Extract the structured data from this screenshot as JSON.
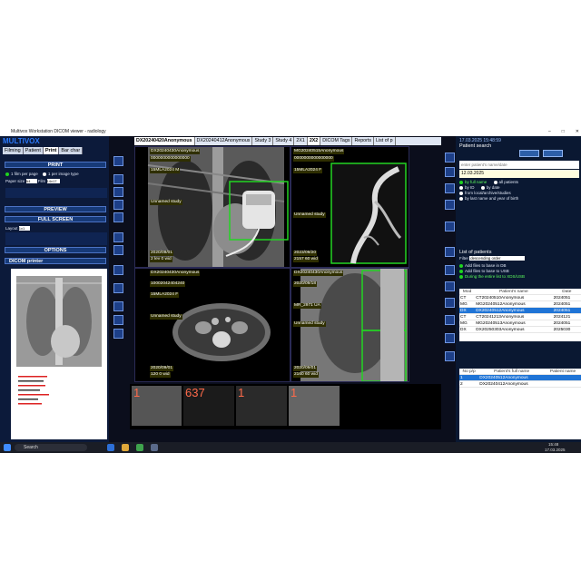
{
  "window": {
    "title": "Multivox Workstation DICOM viewer - radiology"
  },
  "left": {
    "brand": "MULTIVOX",
    "tabs": [
      "Filming",
      "Patient",
      "Print",
      "Bar char"
    ],
    "print_btn": "PRINT",
    "opt1": "1 film per page",
    "opt2": "1 per image type",
    "paper_label": "Paper size",
    "paper_val": "A4",
    "film_label": "Film",
    "film_val": "14x17",
    "preview_btn": "PREVIEW",
    "fullscreen_btn": "FULL SCREEN",
    "layout_label": "Layout",
    "layout_val": "1x1",
    "options_btn": "OPTIONS",
    "printer_btn": "DICOM printer"
  },
  "viewer": {
    "tabs": [
      "DX20240420Anonymous",
      "DX20240412Anonymous",
      "Study 3",
      "Study 4",
      "2X1",
      "2X2",
      "DICOM Tags",
      "Reports",
      "List of p"
    ],
    "vp1": {
      "name": "DX20240430Anonymous",
      "id": "0000000000000000",
      "date": "15MLA2024 M",
      "study": "Unnamed study",
      "dims": "2020/09/01",
      "wl": "2 lev 0 wid"
    },
    "vp2": {
      "name": "MG20240515Anonymous",
      "id": "0000000000000000",
      "date": "15MLA2024 F",
      "study": "Unnamed study",
      "dims": "2023/09/20",
      "wl": "2157 60 wid"
    },
    "vp3": {
      "name": "DX20240430Anonymous",
      "id": "10002042404240",
      "date": "15MLA2024 F",
      "study": "Unnamed study",
      "dims": "2020/09/01",
      "wl": "120 0 wid"
    },
    "vp4": {
      "name": "DX20240430Anonymous",
      "id": "2020/09/18",
      "date": "MR_2971 UA",
      "study": "Unnamed study",
      "dims": "2020/09/01",
      "wl": "2160 60 wid"
    },
    "thumbs": [
      "1",
      "637",
      "1",
      "1"
    ]
  },
  "right": {
    "clock": "17.03.2025 15:48:59",
    "title": "Patient search",
    "search_placeholder": "enter patient's name/date",
    "date_field": "12.03.2025",
    "radios": [
      "by full name",
      "all patients",
      "by ID",
      "by date",
      "from local/archive/studies",
      "by last name and year of birth"
    ],
    "list_title": "List of patients",
    "filter_label": "Filter",
    "filter_val": "descending order",
    "chk1": "Add files to base in DB",
    "chk2": "Add files to base to USB",
    "chk3": "During the entire list to XDS/USB",
    "table_head": [
      "Mod",
      "Patient's name",
      "Date"
    ],
    "rows": [
      [
        "CT",
        "CT20240510Anonymous",
        "2024051"
      ],
      [
        "MG",
        "MG20240512Anonymous",
        "2024051"
      ],
      [
        "DX",
        "DX20240512Anonymous",
        "2024051"
      ],
      [
        "CT",
        "CT20241213Anonymous",
        "2024121"
      ],
      [
        "MG",
        "MG20240513Anonymous",
        "2024051"
      ],
      [
        "DX",
        "DX20250303Anonymous",
        "2025030"
      ]
    ],
    "table2_head": [
      "No p/p",
      "Patient's full name",
      "Patient name"
    ],
    "rows2": [
      [
        "1",
        "DX20240512Anonymous",
        ""
      ],
      [
        "2",
        "DX20240412Anonymous",
        ""
      ]
    ]
  },
  "taskbar": {
    "search": "Search",
    "time": "15:48",
    "date": "17.03.2025"
  }
}
